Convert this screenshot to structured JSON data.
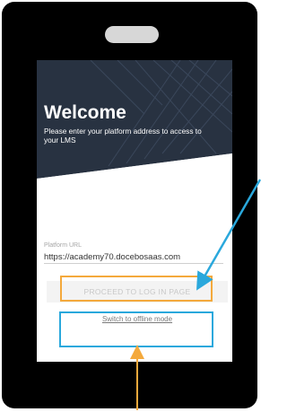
{
  "welcome": {
    "title": "Welcome",
    "subtitle": "Please enter your platform address to access to your LMS"
  },
  "form": {
    "url_label": "Platform URL",
    "url_value": "https://academy70.docebosaas.com"
  },
  "buttons": {
    "proceed_label": "PROCEED TO LOG IN PAGE",
    "offline_label": "Switch to offline mode"
  },
  "colors": {
    "device": "#000000",
    "hero": "#2a3341",
    "highlight_orange": "#f4a93c",
    "highlight_blue": "#2aa8dc"
  }
}
